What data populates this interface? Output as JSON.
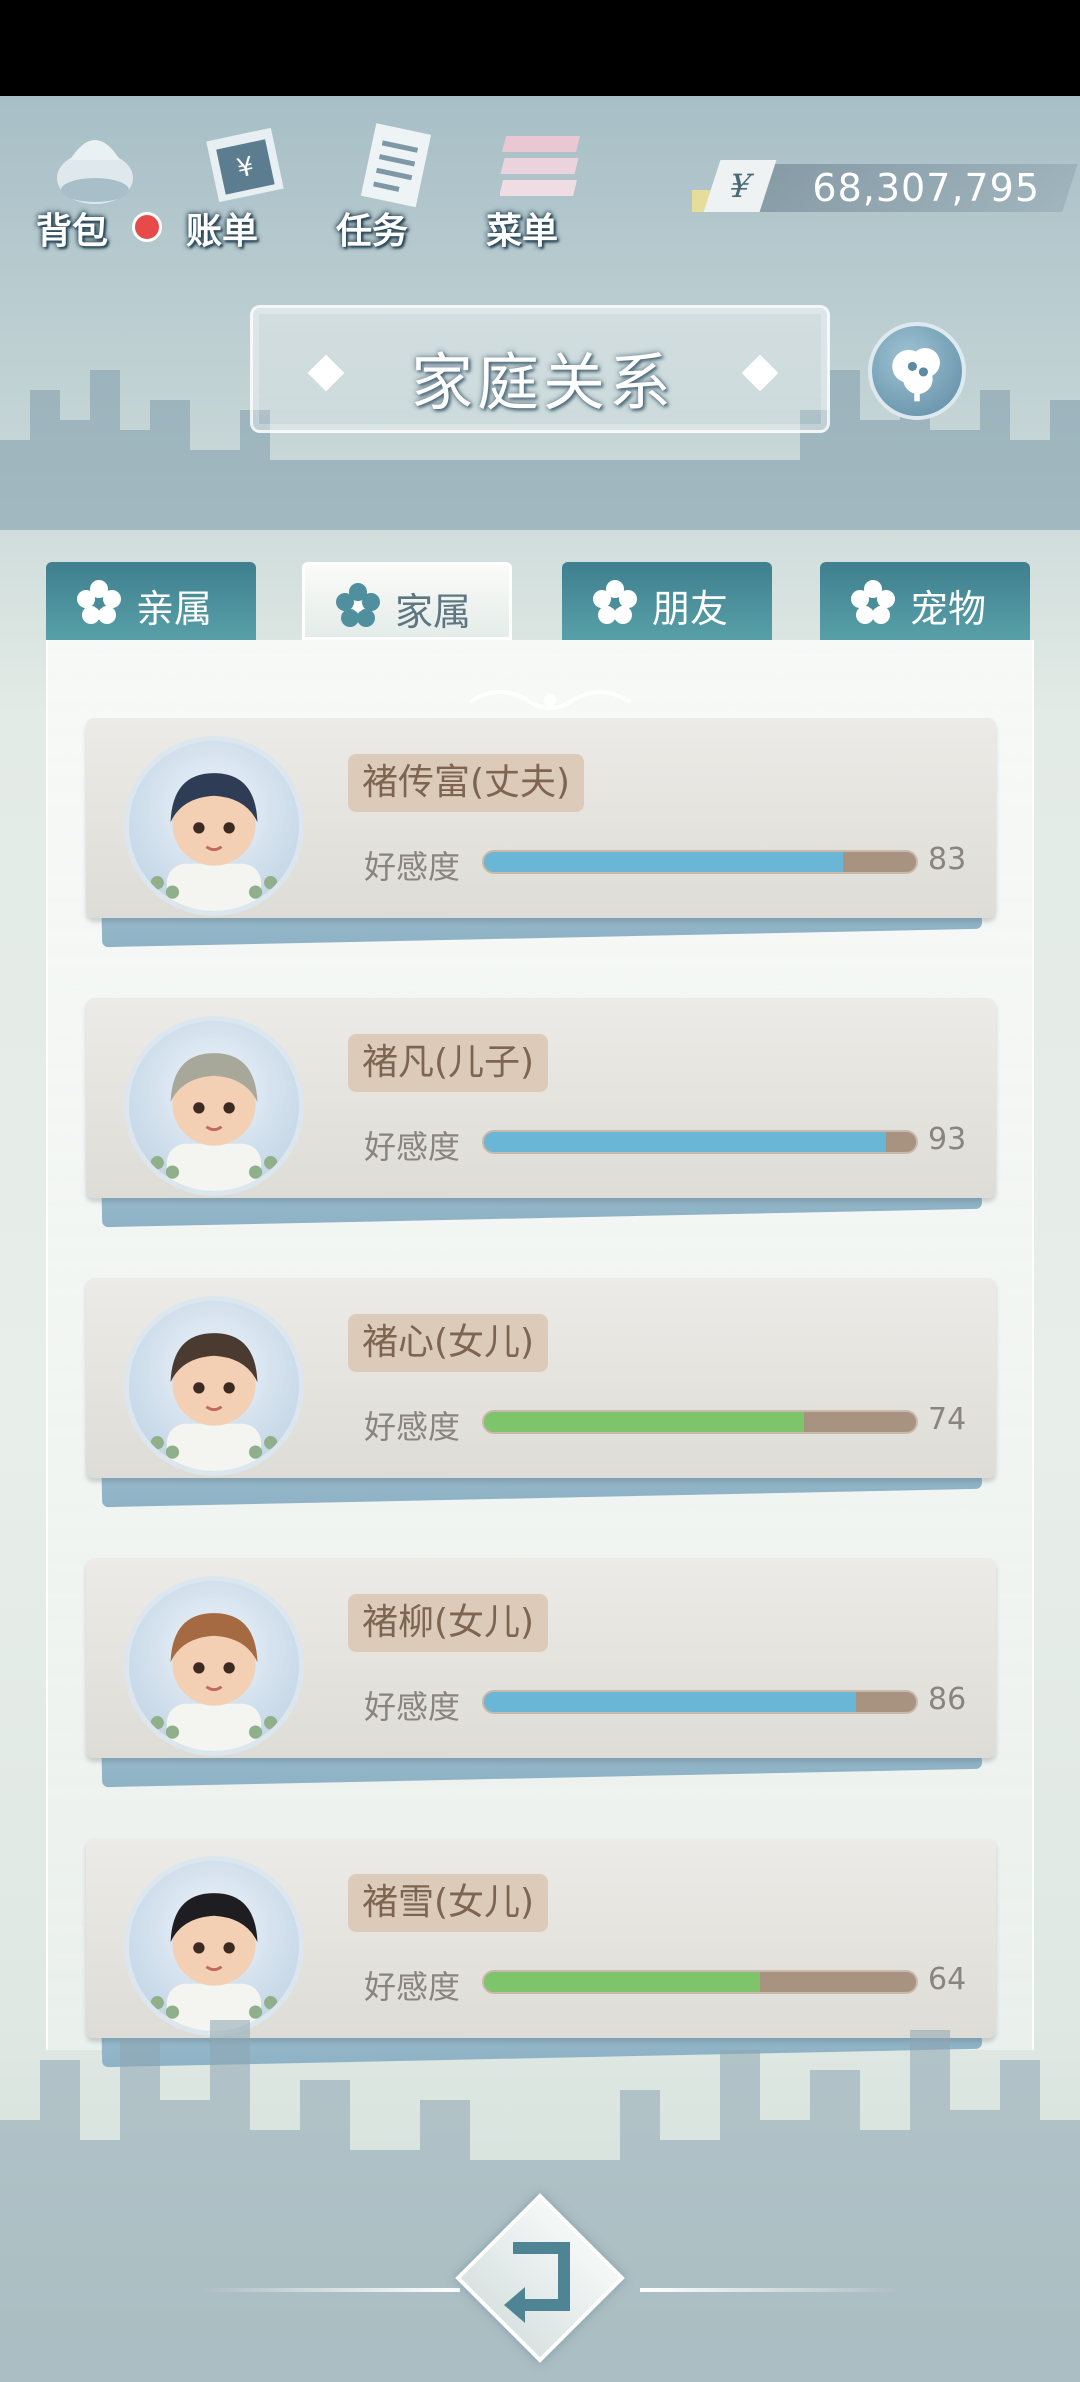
{
  "toolbar": {
    "items": [
      {
        "label": "背包",
        "icon": "bag-icon"
      },
      {
        "label": "账单",
        "icon": "bill-icon"
      },
      {
        "label": "任务",
        "icon": "task-icon"
      },
      {
        "label": "菜单",
        "icon": "menu-icon"
      }
    ],
    "money": {
      "symbol": "¥",
      "amount": "68,307,795"
    }
  },
  "title": "家庭关系",
  "tabs": [
    {
      "label": "亲属",
      "active": false
    },
    {
      "label": "家属",
      "active": true
    },
    {
      "label": "朋友",
      "active": false
    },
    {
      "label": "宠物",
      "active": false
    }
  ],
  "members": [
    {
      "name": "褚传富(丈夫)",
      "favor_label": "好感度",
      "value": "83",
      "progress": 0.83,
      "bar_color": "#6ab6d6"
    },
    {
      "name": "褚凡(儿子)",
      "favor_label": "好感度",
      "value": "93",
      "progress": 0.93,
      "bar_color": "#6ab6d6"
    },
    {
      "name": "褚心(女儿)",
      "favor_label": "好感度",
      "value": "74",
      "progress": 0.74,
      "bar_color": "#7dc46a"
    },
    {
      "name": "褚柳(女儿)",
      "favor_label": "好感度",
      "value": "86",
      "progress": 0.86,
      "bar_color": "#6ab6d6"
    },
    {
      "name": "褚雪(女儿)",
      "favor_label": "好感度",
      "value": "64",
      "progress": 0.64,
      "bar_color": "#7dc46a"
    }
  ],
  "colors": {
    "tab_inactive": "#4a8d98",
    "accent_name_bg": "#dccbb8"
  }
}
